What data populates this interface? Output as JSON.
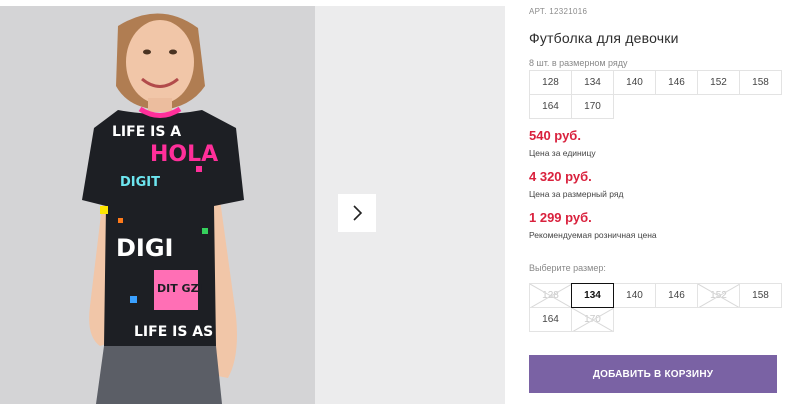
{
  "product": {
    "article": "АРТ. 12321016",
    "title": "Футболка для девочки",
    "pack_note": "8 шт. в размерном ряду",
    "pack_sizes": [
      "128",
      "134",
      "140",
      "146",
      "152",
      "158",
      "164",
      "170"
    ],
    "prices": [
      {
        "value": "540 руб.",
        "label": "Цена за единицу"
      },
      {
        "value": "4 320 руб.",
        "label": "Цена за размерный ряд"
      },
      {
        "value": "1 299 руб.",
        "label": "Рекомендуемая розничная цена"
      }
    ],
    "choose_size_label": "Выберите размер:",
    "size_options": [
      {
        "label": "128",
        "state": "disabled"
      },
      {
        "label": "134",
        "state": "selected"
      },
      {
        "label": "140",
        "state": "available"
      },
      {
        "label": "146",
        "state": "available"
      },
      {
        "label": "152",
        "state": "disabled"
      },
      {
        "label": "158",
        "state": "available"
      },
      {
        "label": "164",
        "state": "available"
      },
      {
        "label": "170",
        "state": "disabled"
      }
    ],
    "add_to_cart_label": "ДОБАВИТЬ В КОРЗИНУ"
  },
  "gallery": {
    "next_icon": "chevron-right-icon",
    "shirt_print": {
      "row1": "LIFE IS A",
      "row2": "HOLA",
      "row3": "DIGIT",
      "row4": "DIGI",
      "row5": "DIT GZI",
      "row6": "LIFE IS AS"
    }
  },
  "colors": {
    "price": "#d9213d",
    "button": "#7a62a4",
    "selected_border": "#111111"
  }
}
